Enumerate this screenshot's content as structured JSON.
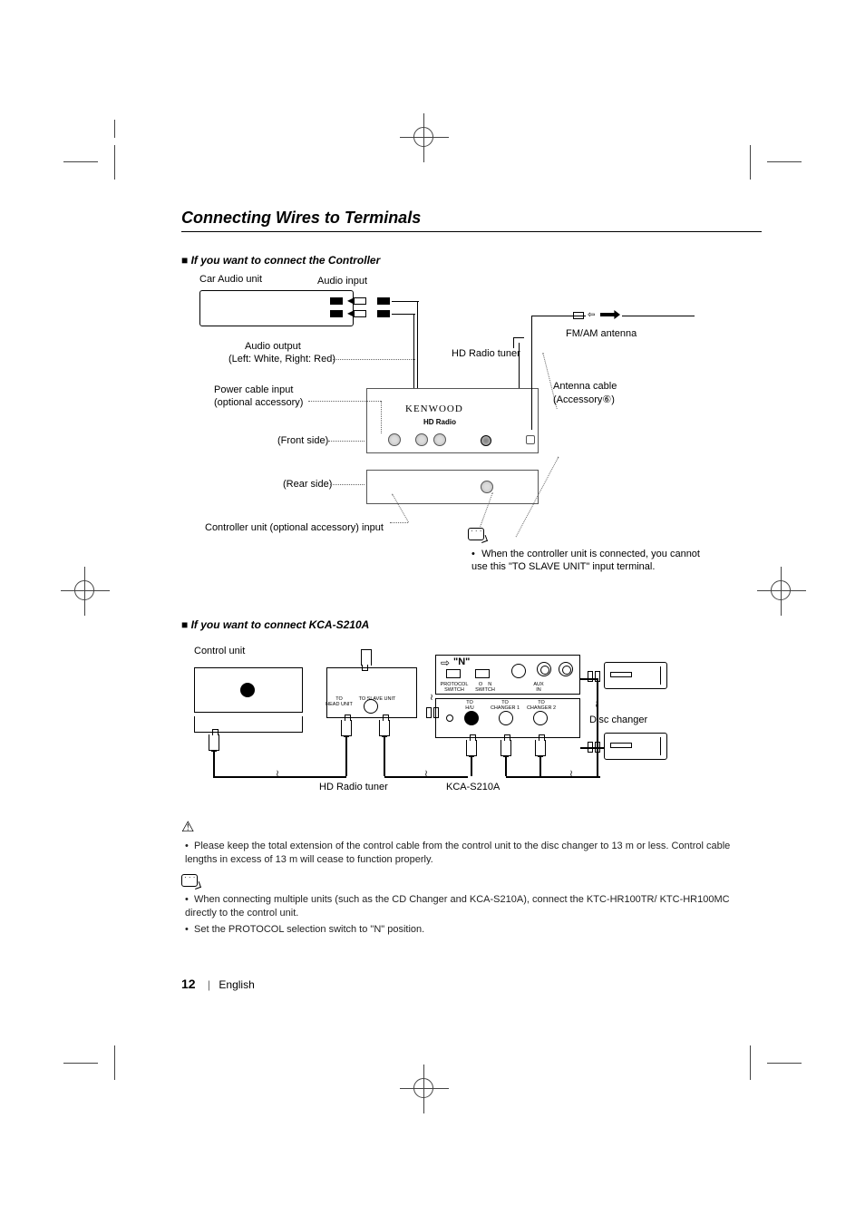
{
  "page": {
    "section_title": "Connecting Wires to Terminals",
    "number": "12",
    "language": "English"
  },
  "diagram1": {
    "heading": "If you want to connect the Controller",
    "labels": {
      "car_audio_unit": "Car Audio unit",
      "audio_input": "Audio input",
      "audio_output_l1": "Audio output",
      "audio_output_l2": "(Left: White, Right: Red)",
      "power_cable_l1": "Power cable input",
      "power_cable_l2": "(optional accessory)",
      "front_side": "(Front side)",
      "rear_side": "(Rear side)",
      "controller_input": "Controller unit (optional accessory) input",
      "hd_radio_tuner": "HD Radio tuner",
      "fm_am_antenna": "FM/AM antenna",
      "antenna_cable_l1": "Antenna cable",
      "antenna_cable_l2": "(Accessory⑥)",
      "brand": "KENWOOD",
      "brand_sub": "HD Radio",
      "note": "When the controller unit is connected, you cannot use this \"TO SLAVE UNIT\" input terminal."
    }
  },
  "diagram2": {
    "heading": "If you want to connect KCA-S210A",
    "labels": {
      "control_unit": "Control unit",
      "hd_radio_tuner": "HD Radio tuner",
      "kca": "KCA-S210A",
      "disc_changer": "Disc changer",
      "n_label": "\"N\"",
      "to_head_unit": "TO\nHEAD UNIT",
      "to_slave_unit": "TO SLAVE UNIT",
      "to_hu": "TO\nH/U",
      "to_changer1": "TO\nCHANGER 1",
      "to_changer2": "TO\nCHANGER 2",
      "protocol_switch": "PROTOCOL\nSWITCH",
      "o_n_switch": "O    N\nSWITCH",
      "aux_in": "AUX\nIN"
    }
  },
  "notes": {
    "warn1": "Please keep the total extension of the control cable from the control unit to the disc changer to 13 m or less. Control cable lengths in excess of 13 m will cease to function properly.",
    "info1": "When connecting multiple units (such as the CD Changer and KCA-S210A), connect the KTC-HR100TR/ KTC-HR100MC directly to the control unit.",
    "info2": "Set the PROTOCOL selection switch to \"N\" position."
  }
}
